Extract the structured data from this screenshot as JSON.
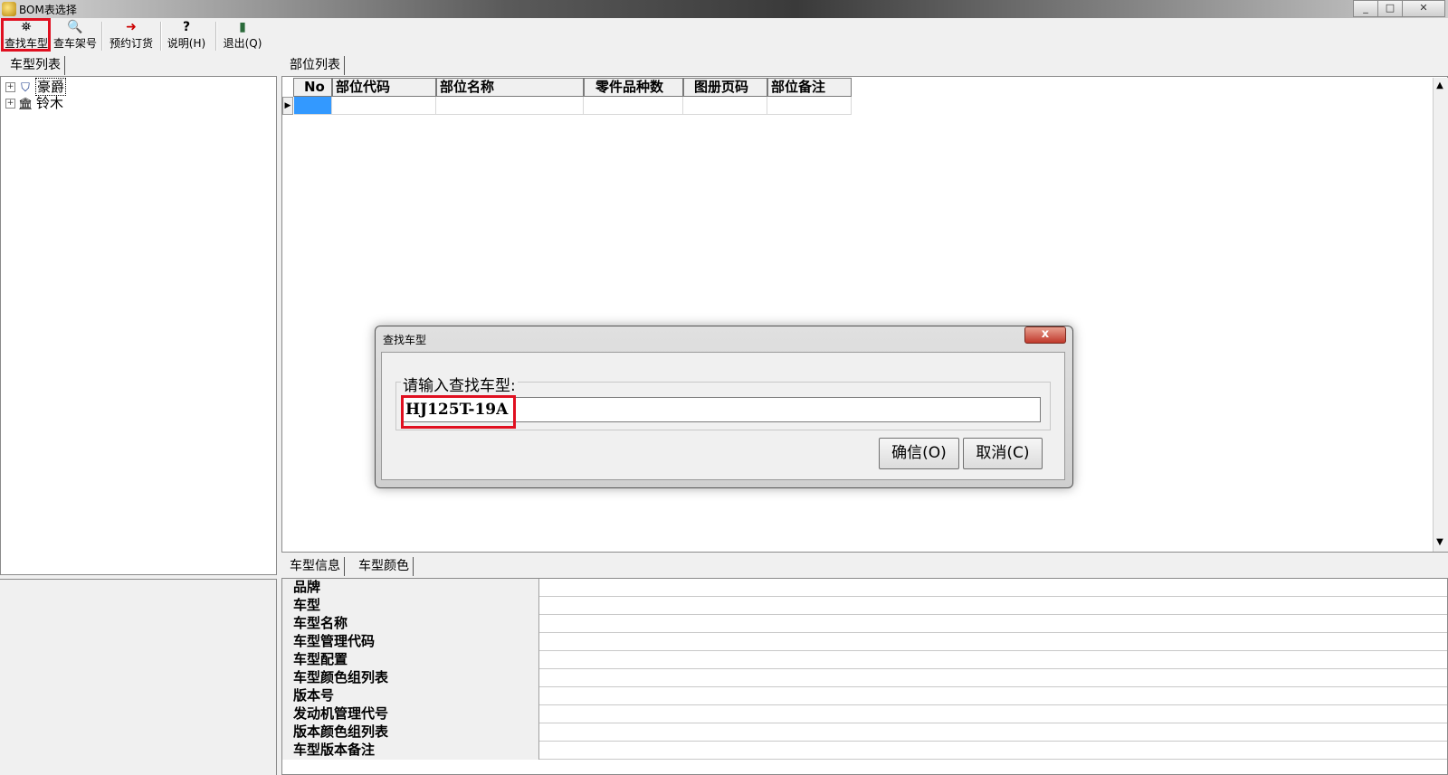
{
  "window": {
    "title": "BOM表选择",
    "min": "_",
    "max": "□",
    "close": "✕"
  },
  "toolbar": [
    {
      "label": "查找车型",
      "icon": "binoculars-icon",
      "glyph": "⛯"
    },
    {
      "label": "查车架号",
      "icon": "magnifier-icon",
      "glyph": "🔍"
    },
    {
      "label": "预约订货",
      "icon": "order-arrow-icon",
      "glyph": "➜"
    },
    {
      "label": "说明(H)",
      "icon": "help-icon",
      "glyph": "?"
    },
    {
      "label": "退出(Q)",
      "icon": "exit-door-icon",
      "glyph": "▮"
    }
  ],
  "left": {
    "tab": "车型列表",
    "tree": [
      {
        "label": "豪爵",
        "icon": "brand-shield-icon",
        "glyph": "⛉",
        "expander": "+"
      },
      {
        "label": "铃木",
        "icon": "brand-building-icon",
        "glyph": "🏛",
        "expander": "+"
      }
    ]
  },
  "parts": {
    "tab": "部位列表",
    "columns": [
      "No",
      "部位代码",
      "部位名称",
      "零件品种数",
      "图册页码",
      "部位备注"
    ],
    "row_indicator": "▶",
    "scroll_up": "▲",
    "scroll_down": "▼"
  },
  "info": {
    "tabs": [
      "车型信息",
      "车型颜色"
    ],
    "rows": [
      "品牌",
      "车型",
      "车型名称",
      "车型管理代码",
      "车型配置",
      "车型颜色组列表",
      "版本号",
      "发动机管理代号",
      "版本颜色组列表",
      "车型版本备注"
    ]
  },
  "dialog": {
    "title": "查找车型",
    "close": "x",
    "group_label": "请输入查找车型:",
    "input_value": "HJ125T-19A",
    "ok": "确信(O)",
    "cancel": "取消(C)"
  }
}
